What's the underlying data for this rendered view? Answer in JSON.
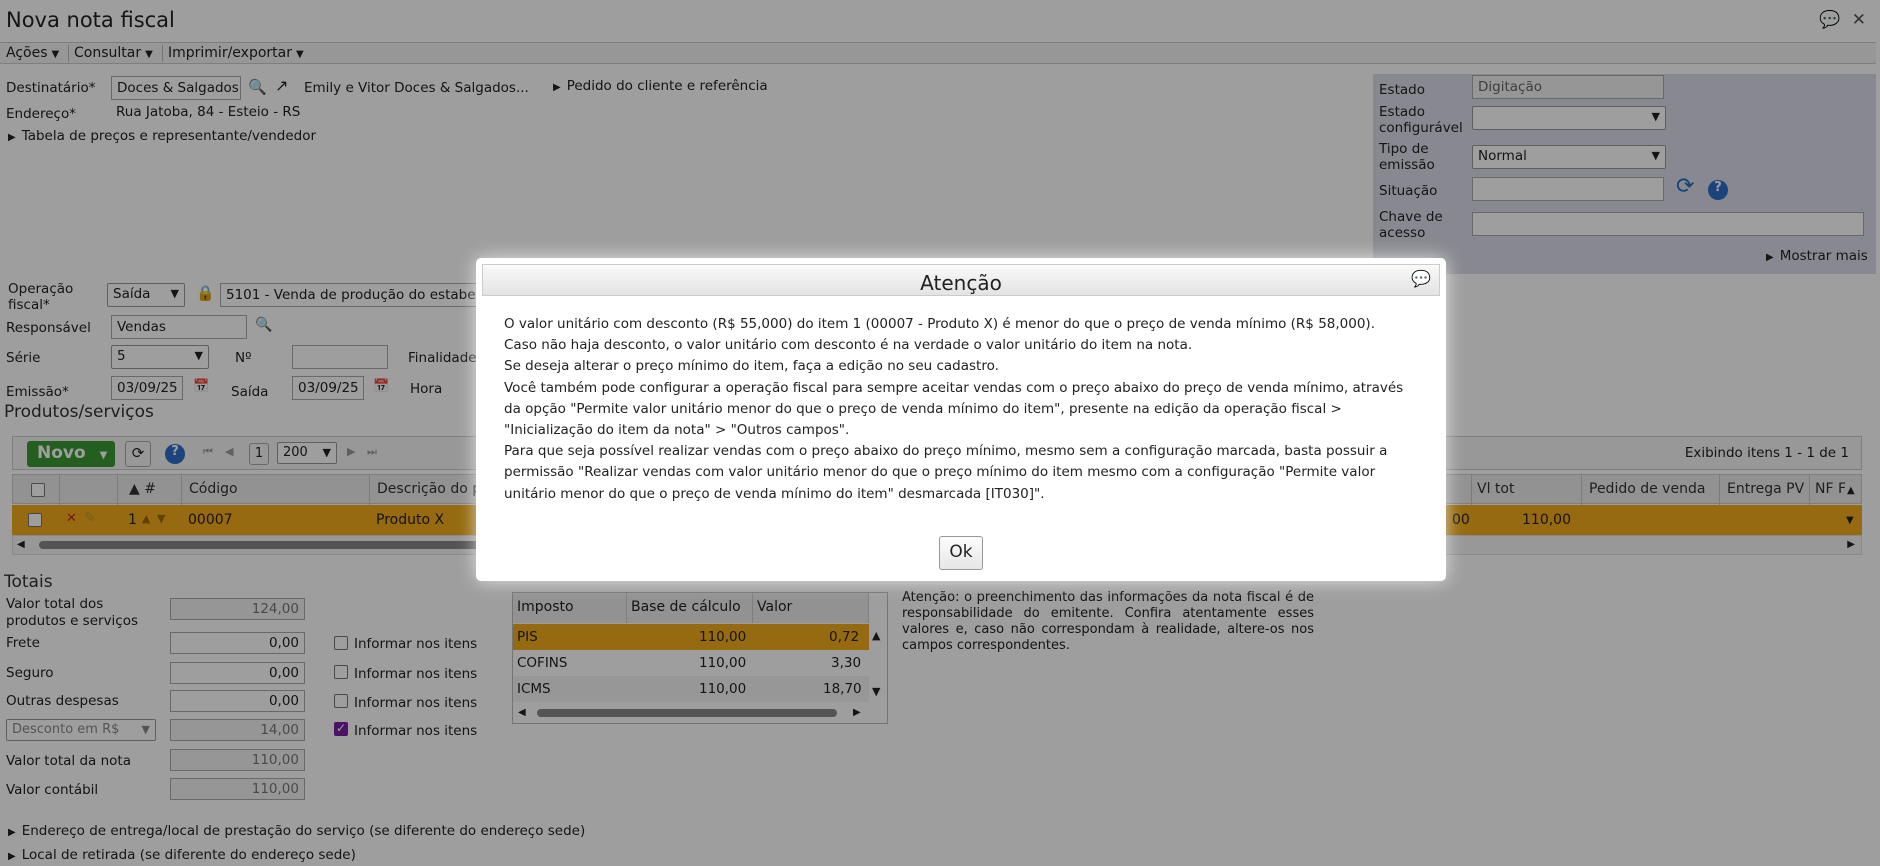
{
  "window": {
    "title": "Nova nota fiscal",
    "chat_icon": "💬",
    "close_icon": "✕"
  },
  "menu": [
    {
      "label": "Ações"
    },
    {
      "label": "Consultar"
    },
    {
      "label": "Imprimir/exportar"
    }
  ],
  "header": {
    "destinatario_label": "Destinatário*",
    "destinatario_value": "Doces & Salgados",
    "destinatario_full": "Emily e Vitor Doces & Salgados...",
    "pedido_link": "Pedido do cliente e referência",
    "endereco_label": "Endereço*",
    "endereco_value": "Rua Jatoba, 84 - Esteio - RS",
    "tabela_link": "Tabela de preços e representante/vendedor"
  },
  "status_panel": {
    "estado_label": "Estado",
    "estado_value": "Digitação",
    "estado_conf_label_1": "Estado",
    "estado_conf_label_2": "configurável",
    "tipo_label_1": "Tipo de",
    "tipo_label_2": "emissão",
    "tipo_value": "Normal",
    "situacao_label": "Situação",
    "chave_label_1": "Chave de",
    "chave_label_2": "acesso",
    "mostrar_mais": "Mostrar mais"
  },
  "fiscal": {
    "operacao_label_1": "Operação",
    "operacao_label_2": "fiscal*",
    "operacao_tipo": "Saída",
    "cfop": "5101 - Venda de produção do estabe",
    "responsavel_label": "Responsável",
    "responsavel_value": "Vendas",
    "serie_label": "Série",
    "serie_value": "5",
    "numero_label": "Nº",
    "finalidade_label": "Finalidade",
    "emissao_label": "Emissão*",
    "emissao_value": "03/09/25",
    "saida_label": "Saída",
    "saida_value": "03/09/25",
    "hora_label": "Hora"
  },
  "products": {
    "section_title": "Produtos/serviços",
    "new_button": "Novo",
    "page": "1",
    "page_size": "200",
    "displaying": "Exibindo itens 1 - 1 de 1",
    "columns": [
      "#",
      "Código",
      "Descrição do p",
      "Vl tot",
      "Pedido de venda",
      "Entrega PV",
      "NF F"
    ],
    "row": {
      "num": "1",
      "codigo": "00007",
      "descricao": "Produto X",
      "partial": "00",
      "vl_tot": "110,00"
    }
  },
  "totals": {
    "section_title": "Totais",
    "valor_produtos_label_1": "Valor total dos",
    "valor_produtos_label_2": "produtos e serviços",
    "valor_produtos": "124,00",
    "frete_label": "Frete",
    "frete": "0,00",
    "seguro_label": "Seguro",
    "seguro": "0,00",
    "outras_label": "Outras despesas",
    "outras": "0,00",
    "desconto_select": "Desconto em R$",
    "desconto": "14,00",
    "valor_nota_label": "Valor total da nota",
    "valor_nota": "110,00",
    "valor_contabil_label": "Valor contábil",
    "valor_contabil": "110,00",
    "informar_label": "Informar nos itens"
  },
  "taxes": {
    "columns": [
      "Imposto",
      "Base de cálculo",
      "Valor"
    ],
    "rows": [
      {
        "imposto": "PIS",
        "base": "110,00",
        "valor": "0,72"
      },
      {
        "imposto": "COFINS",
        "base": "110,00",
        "valor": "3,30"
      },
      {
        "imposto": "ICMS",
        "base": "110,00",
        "valor": "18,70"
      }
    ]
  },
  "notice": "Atenção: o preenchimento das informações da nota fiscal é de responsabilidade do emitente. Confira atentamente esses valores e, caso não correspondam à realidade, altere-os nos campos correspondentes.",
  "footer_links": [
    "Endereço de entrega/local de prestação do serviço (se diferente do endereço sede)",
    "Local de retirada (se diferente do endereço sede)"
  ],
  "modal": {
    "title": "Atenção",
    "lines": [
      "O valor unitário com desconto (R$ 55,000) do item 1 (00007 - Produto X) é menor do que o preço de venda mínimo (R$ 58,000).",
      "Caso não haja desconto, o valor unitário com desconto é na verdade o valor unitário do item na nota.",
      "Se deseja alterar o preço mínimo do item, faça a edição no seu cadastro.",
      "Você também pode configurar a operação fiscal para sempre aceitar vendas com o preço abaixo do preço de venda mínimo, através da opção \"Permite valor unitário menor do que o preço de venda mínimo do item\", presente na edição da operação fiscal > \"Inicialização do item da nota\" > \"Outros campos\".",
      "Para que seja possível realizar vendas com o preço abaixo do preço mínimo, mesmo sem a configuração marcada, basta possuir a permissão \"Realizar vendas com valor unitário menor do que o preço mínimo do item mesmo com a configuração \"Permite valor unitário menor do que o preço de venda mínimo do item\" desmarcada [IT030]\"."
    ],
    "ok_label": "Ok"
  }
}
